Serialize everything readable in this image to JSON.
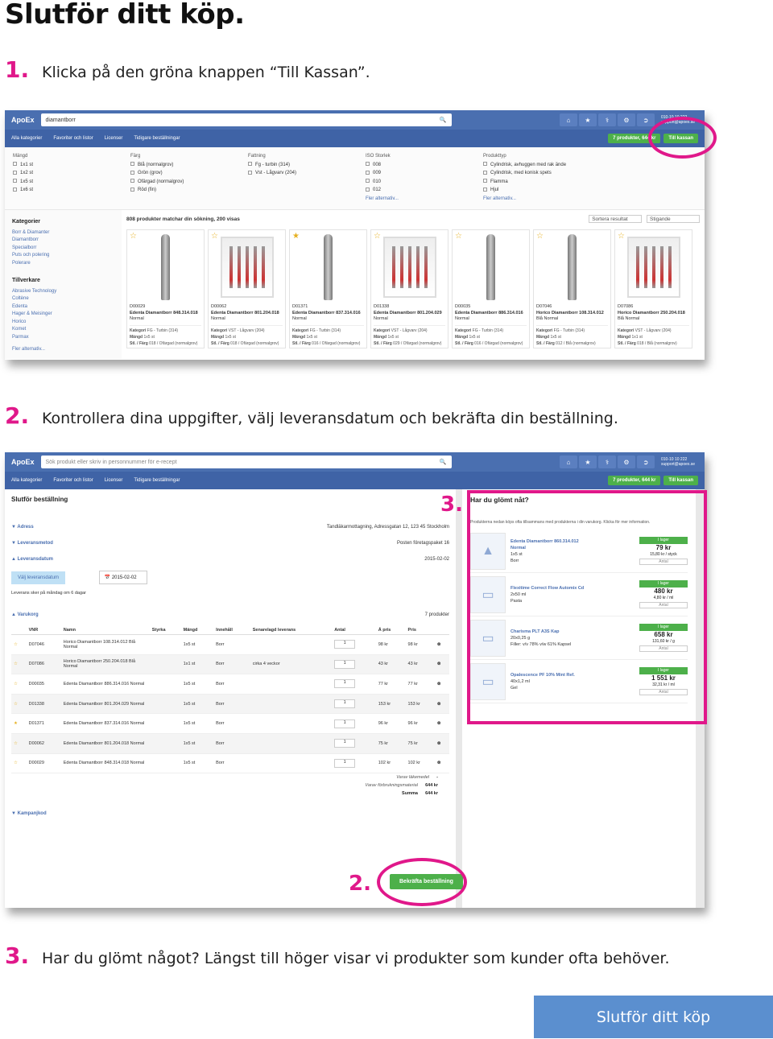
{
  "page_title": "Slutför ditt köp.",
  "steps": [
    {
      "num": "1.",
      "text": "Klicka på den gröna knappen “Till Kassan”."
    },
    {
      "num": "2.",
      "text": "Kontrollera dina uppgifter, välj leveransdatum och bekräfta din beställning."
    },
    {
      "num": "3.",
      "text": "Har du glömt något? Längst till höger visar vi produkter som kunder ofta behöver."
    }
  ],
  "overlay_labels": {
    "three": "3.",
    "two": "2."
  },
  "cta_button": "Slutför ditt köp",
  "app": {
    "logo": "ApoEx",
    "account_line1": "010-10 10 222",
    "account_line2": "support@apoex.se",
    "nav": [
      "Alla kategorier",
      "Favoriter och listor",
      "Licenser",
      "Tidigare beställningar"
    ],
    "cart_button": "7 produkter, 644 kr",
    "checkout_button": "Till kassan"
  },
  "shot1": {
    "search_value": "diamantborr",
    "filters": [
      {
        "title": "Mängd",
        "options": [
          "1x1 st",
          "1x2 st",
          "1x5 st",
          "1x6 st"
        ],
        "more": ""
      },
      {
        "title": "Färg",
        "options": [
          "Blå (normalgrov)",
          "Grön (grov)",
          "Ofärgad (normalgrov)",
          "Röd (fin)"
        ],
        "more": ""
      },
      {
        "title": "Fattning",
        "options": [
          "Fg - turbin (314)",
          "Vst - Lågvarv (204)"
        ],
        "more": ""
      },
      {
        "title": "ISO Storlek",
        "options": [
          "008",
          "009",
          "010",
          "012"
        ],
        "more": "Fler alternativ..."
      },
      {
        "title": "Produkttyp",
        "options": [
          "Cylindrisk, avhuggen med rak ände",
          "Cylindrisk, med konisk spets",
          "Flamma",
          "Hjul"
        ],
        "more": "Fler alternativ..."
      }
    ],
    "sidebar": {
      "kategorier_title": "Kategorier",
      "kategorier": [
        "Borr & Diamanter",
        "Diamantborr",
        "Specialborr",
        "Puts och polering",
        "Polerare"
      ],
      "tillverkare_title": "Tillverkare",
      "tillverkare": [
        "Abrasive Technology",
        "Coltène",
        "Edenta",
        "Hager & Meisinger",
        "Horico",
        "Komet",
        "Parmax"
      ],
      "more": "Fler alternativ..."
    },
    "results_text": "808 produkter matchar din sökning, 200 visas",
    "sort_label": "Sortera resultat",
    "order_label": "Stigande",
    "products": [
      {
        "id": "D00029",
        "name": "Edenta Diamantborr 848.314.018",
        "grade": "Normal",
        "kategori": "FG - Turbin (314)",
        "mangd": "1x5 st",
        "stl": "018 / Ofärgad (normalgrov)",
        "img": "drill"
      },
      {
        "id": "D00062",
        "name": "Edenta Diamantborr 801.204.018",
        "grade": "Normal",
        "kategori": "VST - Lågvarv (204)",
        "mangd": "1x5 st",
        "stl": "018 / Ofärgad (normalgrov)",
        "img": "box"
      },
      {
        "id": "D01371",
        "name": "Edenta Diamantborr 837.314.016",
        "grade": "Normal",
        "kategori": "FG - Turbin (314)",
        "mangd": "1x5 st",
        "stl": "016 / Ofärgad (normalgrov)",
        "img": "drill"
      },
      {
        "id": "D01338",
        "name": "Edenta Diamantborr 801.204.029",
        "grade": "Normal",
        "kategori": "VST - Lågvarv (204)",
        "mangd": "1x5 st",
        "stl": "029 / Ofärgad (normalgrov)",
        "img": "box"
      },
      {
        "id": "D00035",
        "name": "Edenta Diamantborr 886.314.016",
        "grade": "Normal",
        "kategori": "FG - Turbin (314)",
        "mangd": "1x5 st",
        "stl": "016 / Ofärgad (normalgrov)",
        "img": "drill"
      },
      {
        "id": "D07046",
        "name": "Horico Diamantborr 108.314.012",
        "grade": "Blå Normal",
        "kategori": "FG - Turbin (314)",
        "mangd": "1x5 st",
        "stl": "012 / Blå (normalgrov)",
        "img": "drill"
      },
      {
        "id": "D07086",
        "name": "Horico Diamantborr 250.204.018",
        "grade": "Blå Normal",
        "kategori": "VST - Lågvarv (204)",
        "mangd": "1x1 st",
        "stl": "018 / Blå (normalgrov)",
        "img": "box"
      }
    ]
  },
  "shot2": {
    "search_placeholder": "Sök produkt eller skriv in personnummer för e-recept",
    "checkout_title": "Slutför beställning",
    "adress_label": "Adress",
    "adress_value": "Tandläkarmottagning, Adressgatan 12, 123 45 Stockholm",
    "leveransmetod_label": "Leveransmetod",
    "leveransmetod_value": "Posten företagspaket 16",
    "leveransdatum_label": "Leveransdatum",
    "leveransdatum_value": "2015-02-02",
    "choose_date": "Välj leveransdatum",
    "date_input": "2015-02-02",
    "delivery_note": "Leverans sker på måndag om 6 dagar",
    "varukorg_label": "Varukorg",
    "varukorg_count": "7 produkter",
    "columns": [
      "VNR",
      "Namn",
      "Styrka",
      "Mängd",
      "Innehåll",
      "Senarelagd leverans",
      "Antal",
      "Á pris",
      "Pris"
    ],
    "rows": [
      {
        "vnr": "D07046",
        "namn": "Horico Diamantborr 108.314.012 Blå Normal",
        "mangd": "1x5 st",
        "innehall": "Borr",
        "sen": "",
        "antal": "1",
        "apris": "98 kr",
        "pris": "98 kr",
        "fav": false
      },
      {
        "vnr": "D07086",
        "namn": "Horico Diamantborr 250.204.018 Blå Normal",
        "mangd": "1x1 st",
        "innehall": "Borr",
        "sen": "cirka 4 veckor",
        "antal": "1",
        "apris": "43 kr",
        "pris": "43 kr",
        "fav": false
      },
      {
        "vnr": "D00035",
        "namn": "Edenta Diamantborr 886.314.016 Normal",
        "mangd": "1x5 st",
        "innehall": "Borr",
        "sen": "",
        "antal": "1",
        "apris": "77 kr",
        "pris": "77 kr",
        "fav": false
      },
      {
        "vnr": "D01338",
        "namn": "Edenta Diamantborr 801.204.029 Normal",
        "mangd": "1x5 st",
        "innehall": "Borr",
        "sen": "",
        "antal": "1",
        "apris": "153 kr",
        "pris": "153 kr",
        "fav": false
      },
      {
        "vnr": "D01371",
        "namn": "Edenta Diamantborr 837.314.016 Normal",
        "mangd": "1x5 st",
        "innehall": "Borr",
        "sen": "",
        "antal": "1",
        "apris": "96 kr",
        "pris": "96 kr",
        "fav": true
      },
      {
        "vnr": "D00062",
        "namn": "Edenta Diamantborr 801.204.018 Normal",
        "mangd": "1x5 st",
        "innehall": "Borr",
        "sen": "",
        "antal": "1",
        "apris": "75 kr",
        "pris": "75 kr",
        "fav": false
      },
      {
        "vnr": "D00029",
        "namn": "Edenta Diamantborr 848.314.018 Normal",
        "mangd": "1x5 st",
        "innehall": "Borr",
        "sen": "",
        "antal": "1",
        "apris": "102 kr",
        "pris": "102 kr",
        "fav": false
      }
    ],
    "varav_lakemedel_label": "Varav läkemedel",
    "varav_lakemedel_value": "-",
    "varav_forbrukning_label": "Varav förbrukningsmaterial",
    "varav_forbrukning_value": "644 kr",
    "summa_label": "Summa",
    "summa_value": "644 kr",
    "kampanjkod_label": "Kampanjkod",
    "confirm_button": "Bekräfta beställning",
    "forgot_title": "Har du glömt nåt?",
    "forgot_lead": "Produkterna nedan köps ofta tillsammans med produkterna i din varukorg. Klicka för mer information.",
    "recommendations": [
      {
        "name": "Edenta Diamantborr 860.314.012",
        "sub": "Normal",
        "l2": "1x5 st",
        "l3": "Borr",
        "stock": "I lager",
        "price": "79 kr",
        "unit": "15,80 kr / styck"
      },
      {
        "name": "Flexitime Correct Flow Automix Cd",
        "sub": "",
        "l2": "2x50 ml",
        "l3": "Pasta",
        "stock": "I lager",
        "price": "480 kr",
        "unit": "4,80 kr / ml"
      },
      {
        "name": "Charisma PLT A3S Kap",
        "sub": "",
        "l2": "20x0,25 g",
        "l3": "Filler: v/v 78% v/w 61% Kapsel",
        "stock": "I lager",
        "price": "658 kr",
        "unit": "131,60 kr / g"
      },
      {
        "name": "Opalescence PF 10% Mint Ref.",
        "sub": "",
        "l2": "40x1,2 ml",
        "l3": "Gel",
        "stock": "I lager",
        "price": "1 551 kr",
        "unit": "32,31 kr / ml"
      }
    ],
    "antal_label": "Antal"
  },
  "colors": {
    "accent": "#e0188a",
    "topbar": "#4a6fb0",
    "green": "#4db04a",
    "cta": "#5b8fcf"
  }
}
